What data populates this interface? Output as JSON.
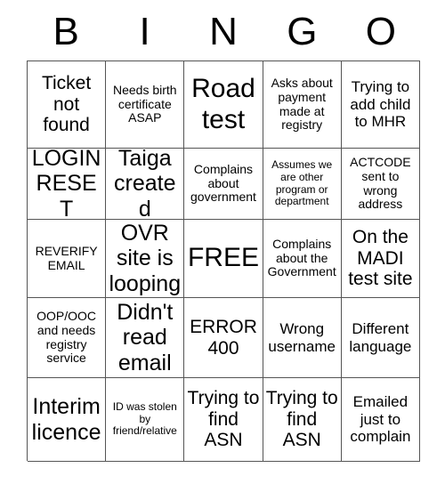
{
  "card": {
    "header_letters": [
      "B",
      "I",
      "N",
      "G",
      "O"
    ],
    "columns": 5,
    "rows": 5,
    "free_space_label": "FREE",
    "colors": {
      "text": "#000000",
      "border": "#555555",
      "background": "#ffffff"
    },
    "cells": [
      [
        {
          "text": "Ticket not found",
          "size": "lg"
        },
        {
          "text": "Needs birth certificate ASAP",
          "size": "sm"
        },
        {
          "text": "Road test",
          "size": "xxl"
        },
        {
          "text": "Asks about payment made at registry",
          "size": "sm"
        },
        {
          "text": "Trying to add child to MHR",
          "size": "md"
        }
      ],
      [
        {
          "text": "LOGIN RESET",
          "size": "xl"
        },
        {
          "text": "Taiga created",
          "size": "xl"
        },
        {
          "text": "Complains about government",
          "size": "sm"
        },
        {
          "text": "Assumes we are other program or department",
          "size": "xs"
        },
        {
          "text": "ACTCODE sent to wrong address",
          "size": "sm"
        }
      ],
      [
        {
          "text": "REVERIFY EMAIL",
          "size": "sm"
        },
        {
          "text": "OVR site is looping",
          "size": "xl"
        },
        {
          "text": "FREE",
          "size": "xxl"
        },
        {
          "text": "Complains about the Government",
          "size": "sm"
        },
        {
          "text": "On the MADI test site",
          "size": "lg"
        }
      ],
      [
        {
          "text": "OOP/OOC and needs registry service",
          "size": "sm"
        },
        {
          "text": "Didn't read email",
          "size": "xl"
        },
        {
          "text": "ERROR 400",
          "size": "lg"
        },
        {
          "text": "Wrong username",
          "size": "md"
        },
        {
          "text": "Different language",
          "size": "md"
        }
      ],
      [
        {
          "text": "Interim licence",
          "size": "xl"
        },
        {
          "text": "ID was stolen by friend/relative",
          "size": "xs"
        },
        {
          "text": "Trying to find ASN",
          "size": "lg"
        },
        {
          "text": "Trying to find ASN",
          "size": "lg"
        },
        {
          "text": "Emailed just to complain",
          "size": "md"
        }
      ]
    ]
  }
}
